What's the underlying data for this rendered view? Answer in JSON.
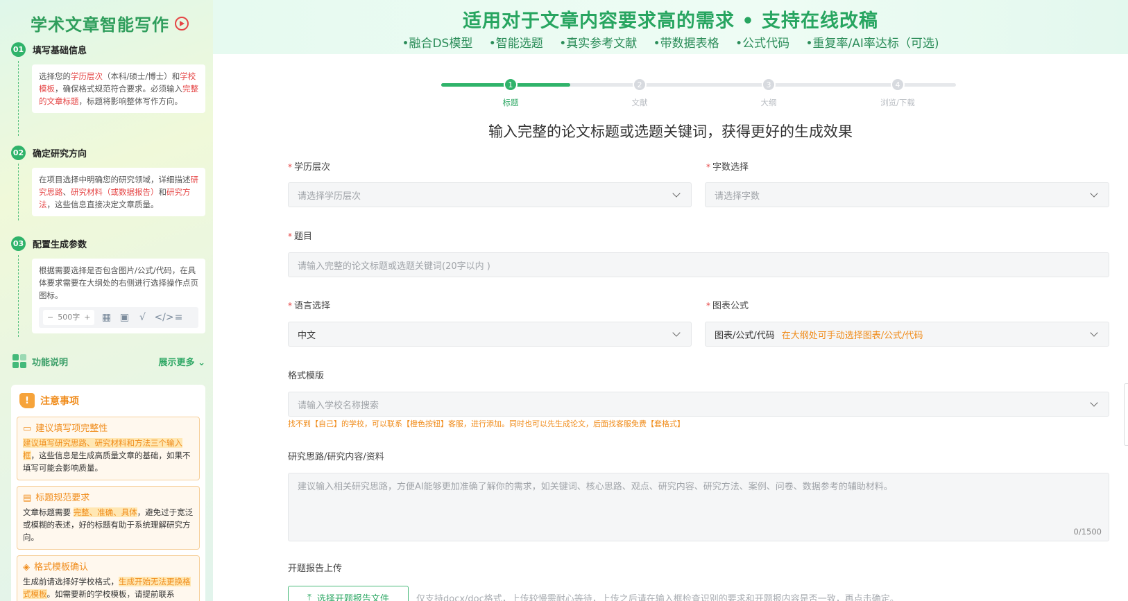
{
  "sidebar": {
    "brand": "学术文章智能写作",
    "steps": [
      {
        "num": "01",
        "title": "填写基础信息",
        "body": [
          {
            "t": "选择您的",
            "red": false
          },
          {
            "t": "学历层次",
            "red": true
          },
          {
            "t": "（本科/硕士/博士）和",
            "red": false
          },
          {
            "t": "学校模板",
            "red": true
          },
          {
            "t": "，确保格式规范符合要求。必须输入",
            "red": false
          },
          {
            "t": "完整的文章标题",
            "red": true
          },
          {
            "t": "，标题将影响整体写作方向。",
            "red": false
          }
        ]
      },
      {
        "num": "02",
        "title": "确定研究方向",
        "body": [
          {
            "t": "在项目选择中明确您的研究领域，详细描述",
            "red": false
          },
          {
            "t": "研究思路",
            "red": true
          },
          {
            "t": "、",
            "red": false
          },
          {
            "t": "研究材料（或数据报告）",
            "red": true
          },
          {
            "t": "和",
            "red": false
          },
          {
            "t": "研究方法",
            "red": true
          },
          {
            "t": "，这些信息直接决定文章质量。",
            "red": false
          }
        ]
      },
      {
        "num": "03",
        "title": "配置生成参数",
        "body": [
          {
            "t": "根据需要选择是否包含图片/公式/代码，在具体要求需要在大纲处的右侧进行选择操作点页图标。",
            "red": false
          }
        ]
      }
    ],
    "options_bar": {
      "minus": "−",
      "count": "500字",
      "plus": "+"
    },
    "feature_label": "功能说明",
    "show_more": "展示更多",
    "notice": {
      "title": "注意事项",
      "tips": [
        {
          "title": "建议填写项完整性",
          "body": [
            {
              "t": "建议填写研究思路、研究材料和方法三个输入框",
              "hl": true
            },
            {
              "t": "，这些信息是生成高质量文章的基础，如果不填写可能会影响质量。",
              "hl": false
            }
          ]
        },
        {
          "title": "标题规范要求",
          "body": [
            {
              "t": "文章标题需要 ",
              "hl": false
            },
            {
              "t": "完整、准确、具体",
              "hl": true
            },
            {
              "t": "，避免过于宽泛或模糊的表述，好的标题有助于系统理解研究方向。",
              "hl": false
            }
          ]
        },
        {
          "title": "格式模板确认",
          "body": [
            {
              "t": "生成前请选择好学校格式，",
              "hl": false
            },
            {
              "t": "生成开始无法更换格式模板",
              "hl": true
            },
            {
              "t": "。如需要新的学校模板，请提前联系",
              "hl": false
            }
          ]
        }
      ]
    }
  },
  "banner": {
    "title": "适用对于文章内容要求高的需求 • 支持在线改稿",
    "tags": [
      "•融合DS模型",
      "•智能选题",
      "•真实参考文献",
      "•带数据表格",
      "•公式代码",
      "•重复率/AI率达标（可选)"
    ]
  },
  "stepper": {
    "steps": [
      {
        "num": "1",
        "label": "标题"
      },
      {
        "num": "2",
        "label": "文献"
      },
      {
        "num": "3",
        "label": "大纲"
      },
      {
        "num": "4",
        "label": "浏览/下载"
      }
    ],
    "progress": 0.25
  },
  "subtitle": "输入完整的论文标题或选题关键词，获得更好的生成效果",
  "form": {
    "required_mark": "*",
    "degree": {
      "label": "学历层次",
      "placeholder": "请选择学历层次"
    },
    "wordcount": {
      "label": "字数选择",
      "placeholder": "请选择字数"
    },
    "topic": {
      "label": "题目",
      "placeholder": "请输入完整的论文标题或选题关键词(20字以内 )"
    },
    "language": {
      "label": "语言选择",
      "value": "中文"
    },
    "charts": {
      "label": "图表公式",
      "value": "图表/公式/代码",
      "hint": "在大纲处可手动选择图表/公式/代码"
    },
    "template": {
      "label": "格式模版",
      "placeholder": "请输入学校名称搜索",
      "warning": "找不到【自己】的学校，可以联系【橙色按钮】客服，进行添加。同时也可以先生成论文，后面找客服免费【套格式】"
    },
    "research": {
      "label": "研究思路/研究内容/资料",
      "placeholder": "建议输入相关研究思路，方便AI能够更加准确了解你的需求，如关键词、核心思路、观点、研究内容、研究方法、案例、问卷、数据参考的辅助材料。",
      "counter": "0/1500"
    },
    "upload": {
      "label": "开题报告上传",
      "button": "选择开题报告文件",
      "hint": "仅支持docx/doc格式，上传较慢需耐心等待，上传之后请在输入框检查识别的要求和开题报内容是否一致，再点击确定。"
    }
  }
}
